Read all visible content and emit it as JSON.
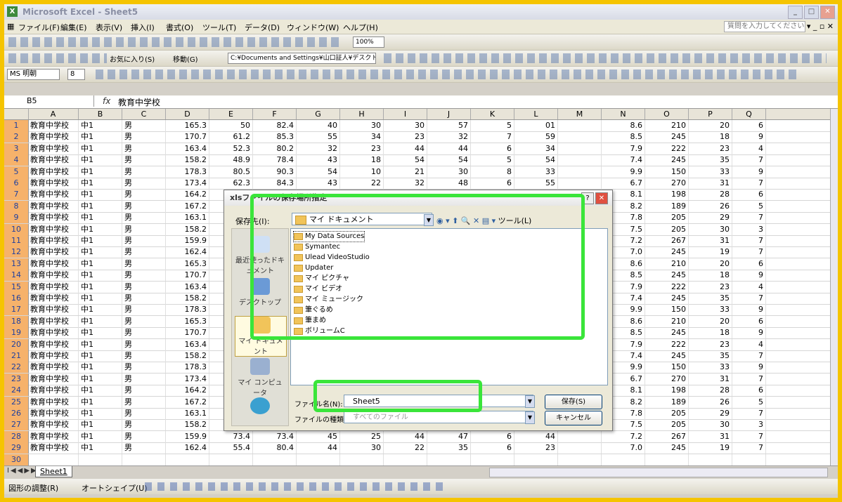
{
  "window": {
    "title": "Microsoft Excel - Sheet5"
  },
  "menu": {
    "items": [
      "ファイル(F)",
      "編集(E)",
      "表示(V)",
      "挿入(I)",
      "書式(O)",
      "ツール(T)",
      "データ(D)",
      "ウィンドウ(W)",
      "ヘルプ(H)"
    ],
    "help_placeholder": "質問を入力してください"
  },
  "toolbar": {
    "zoom": "100%",
    "favorites": "お気に入り(S)",
    "goto": "移動(G)",
    "path": "C:¥Documents and Settings¥山口証人¥デスクトップ¥仕事¥体力テ",
    "font_name": "MS 明朝",
    "font_size": "8"
  },
  "formula": {
    "cell_ref": "B5",
    "fx": "fx",
    "value": "教育中学校"
  },
  "columns": [
    "A",
    "B",
    "C",
    "D",
    "E",
    "F",
    "G",
    "H",
    "I",
    "J",
    "K",
    "L",
    "M",
    "N",
    "O",
    "P",
    "Q"
  ],
  "rows": [
    [
      "教育中学校",
      "中1",
      "男",
      "165.3",
      "50",
      "82.4",
      "40",
      "30",
      "30",
      "57",
      "5",
      "01",
      "",
      "8.6",
      "210",
      "20",
      "6"
    ],
    [
      "教育中学校",
      "中1",
      "男",
      "170.7",
      "61.2",
      "85.3",
      "55",
      "34",
      "23",
      "32",
      "7",
      "59",
      "",
      "8.5",
      "245",
      "18",
      "9"
    ],
    [
      "教育中学校",
      "中1",
      "男",
      "163.4",
      "52.3",
      "80.2",
      "32",
      "23",
      "44",
      "44",
      "6",
      "34",
      "",
      "7.9",
      "222",
      "23",
      "4"
    ],
    [
      "教育中学校",
      "中1",
      "男",
      "158.2",
      "48.9",
      "78.4",
      "43",
      "18",
      "54",
      "54",
      "5",
      "54",
      "",
      "7.4",
      "245",
      "35",
      "7"
    ],
    [
      "教育中学校",
      "中1",
      "男",
      "178.3",
      "80.5",
      "90.3",
      "54",
      "10",
      "21",
      "30",
      "8",
      "33",
      "",
      "9.9",
      "150",
      "33",
      "9"
    ],
    [
      "教育中学校",
      "中1",
      "男",
      "173.4",
      "62.3",
      "84.3",
      "43",
      "22",
      "32",
      "48",
      "6",
      "55",
      "",
      "6.7",
      "270",
      "31",
      "7"
    ],
    [
      "教育中学校",
      "中1",
      "男",
      "164.2",
      "",
      "",
      "",
      "",
      "",
      "",
      "",
      "",
      "",
      "8.1",
      "198",
      "28",
      "6"
    ],
    [
      "教育中学校",
      "中1",
      "男",
      "167.2",
      "",
      "",
      "",
      "",
      "",
      "",
      "",
      "",
      "",
      "8.2",
      "189",
      "26",
      "5"
    ],
    [
      "教育中学校",
      "中1",
      "男",
      "163.1",
      "",
      "",
      "",
      "",
      "",
      "",
      "",
      "",
      "",
      "7.8",
      "205",
      "29",
      "7"
    ],
    [
      "教育中学校",
      "中1",
      "男",
      "158.2",
      "",
      "",
      "",
      "",
      "",
      "",
      "",
      "",
      "",
      "7.5",
      "205",
      "30",
      "3"
    ],
    [
      "教育中学校",
      "中1",
      "男",
      "159.9",
      "",
      "",
      "",
      "",
      "",
      "",
      "",
      "",
      "",
      "7.2",
      "267",
      "31",
      "7"
    ],
    [
      "教育中学校",
      "中1",
      "男",
      "162.4",
      "",
      "",
      "",
      "",
      "",
      "",
      "",
      "",
      "",
      "7.0",
      "245",
      "19",
      "7"
    ],
    [
      "教育中学校",
      "中1",
      "男",
      "165.3",
      "",
      "",
      "",
      "",
      "",
      "",
      "",
      "",
      "",
      "8.6",
      "210",
      "20",
      "6"
    ],
    [
      "教育中学校",
      "中1",
      "男",
      "170.7",
      "",
      "",
      "",
      "",
      "",
      "",
      "",
      "",
      "",
      "8.5",
      "245",
      "18",
      "9"
    ],
    [
      "教育中学校",
      "中1",
      "男",
      "163.4",
      "",
      "",
      "",
      "",
      "",
      "",
      "",
      "",
      "",
      "7.9",
      "222",
      "23",
      "4"
    ],
    [
      "教育中学校",
      "中1",
      "男",
      "158.2",
      "",
      "",
      "",
      "",
      "",
      "",
      "",
      "",
      "",
      "7.4",
      "245",
      "35",
      "7"
    ],
    [
      "教育中学校",
      "中1",
      "男",
      "178.3",
      "",
      "",
      "",
      "",
      "",
      "",
      "",
      "",
      "",
      "9.9",
      "150",
      "33",
      "9"
    ],
    [
      "教育中学校",
      "中1",
      "男",
      "165.3",
      "",
      "",
      "",
      "",
      "",
      "",
      "",
      "",
      "",
      "8.6",
      "210",
      "20",
      "6"
    ],
    [
      "教育中学校",
      "中1",
      "男",
      "170.7",
      "",
      "",
      "",
      "",
      "",
      "",
      "",
      "",
      "",
      "8.5",
      "245",
      "18",
      "9"
    ],
    [
      "教育中学校",
      "中1",
      "男",
      "163.4",
      "",
      "",
      "",
      "",
      "",
      "",
      "",
      "",
      "",
      "7.9",
      "222",
      "23",
      "4"
    ],
    [
      "教育中学校",
      "中1",
      "男",
      "158.2",
      "",
      "",
      "",
      "",
      "",
      "",
      "",
      "",
      "",
      "7.4",
      "245",
      "35",
      "7"
    ],
    [
      "教育中学校",
      "中1",
      "男",
      "178.3",
      "",
      "",
      "",
      "",
      "",
      "",
      "",
      "",
      "",
      "9.9",
      "150",
      "33",
      "9"
    ],
    [
      "教育中学校",
      "中1",
      "男",
      "173.4",
      "",
      "",
      "",
      "",
      "",
      "",
      "",
      "",
      "",
      "6.7",
      "270",
      "31",
      "7"
    ],
    [
      "教育中学校",
      "中1",
      "男",
      "164.2",
      "",
      "",
      "",
      "",
      "",
      "",
      "",
      "",
      "",
      "8.1",
      "198",
      "28",
      "6"
    ],
    [
      "教育中学校",
      "中1",
      "男",
      "167.2",
      "",
      "",
      "",
      "",
      "",
      "",
      "",
      "",
      "",
      "8.2",
      "189",
      "26",
      "5"
    ],
    [
      "教育中学校",
      "中1",
      "男",
      "163.1",
      "",
      "",
      "",
      "",
      "",
      "",
      "",
      "",
      "",
      "7.8",
      "205",
      "29",
      "7"
    ],
    [
      "教育中学校",
      "中1",
      "男",
      "158.2",
      "44.3",
      "72.9",
      "23",
      "22",
      "39",
      "56",
      "5",
      "56",
      "",
      "7.5",
      "205",
      "30",
      "3"
    ],
    [
      "教育中学校",
      "中1",
      "男",
      "159.9",
      "73.4",
      "73.4",
      "45",
      "25",
      "44",
      "47",
      "6",
      "44",
      "",
      "7.2",
      "267",
      "31",
      "7"
    ],
    [
      "教育中学校",
      "中1",
      "男",
      "162.4",
      "55.4",
      "80.4",
      "44",
      "30",
      "22",
      "35",
      "6",
      "23",
      "",
      "7.0",
      "245",
      "19",
      "7"
    ],
    [
      "",
      "",
      "",
      "",
      "",
      "",
      "",
      "",
      "",
      "",
      "",
      "",
      "",
      "",
      "",
      "",
      ""
    ]
  ],
  "sheet_tab": "Sheet1",
  "drawbar": {
    "draw": "図形の調整(R)",
    "autoshape": "オートシェイプ(U)"
  },
  "dialog": {
    "title": "xlsファイルの保存場所指定",
    "look_in_label": "保存先(I):",
    "look_in_value": "マイ ドキュメント",
    "tools": "ツール(L)",
    "places": [
      "最近使ったドキュメント",
      "デスクトップ",
      "マイ ドキュメント",
      "マイ コンピュータ",
      ""
    ],
    "files": [
      "My Data Sources",
      "Symantec",
      "Ulead VideoStudio",
      "Updater",
      "マイ ピクチャ",
      "マイ ビデオ",
      "マイ ミュージック",
      "筆ぐるめ",
      "筆まめ",
      "ボリュームC"
    ],
    "filename_label": "ファイル名(N):",
    "filename_value": "Sheet5",
    "filetype_label": "ファイルの種類(T):",
    "filetype_value": "すべてのファイル",
    "save_button": "保存(S)",
    "cancel_button": "キャンセル"
  },
  "accent_colors": {
    "highlight": "#3ae53a",
    "row_header": "#f6b26b",
    "outer_border": "#f5c400"
  }
}
